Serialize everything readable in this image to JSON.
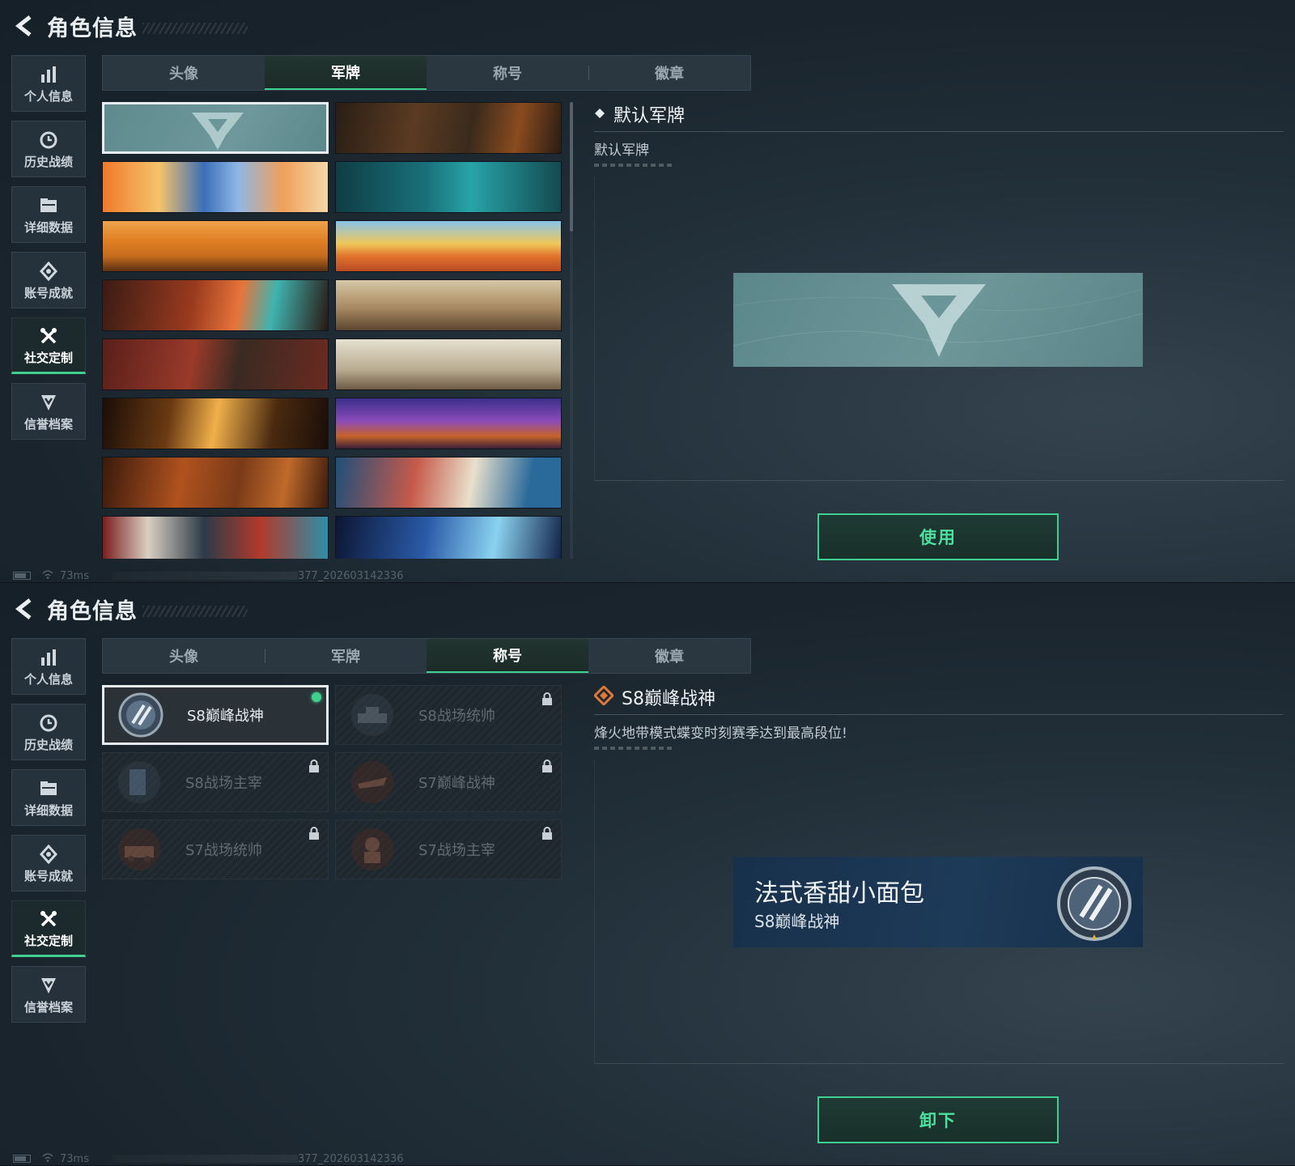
{
  "top": {
    "header": {
      "title": "角色信息"
    },
    "sidebar": [
      {
        "label": "个人信息",
        "icon": "bar-chart-icon"
      },
      {
        "label": "历史战绩",
        "icon": "history-clock-icon"
      },
      {
        "label": "详细数据",
        "icon": "folder-icon"
      },
      {
        "label": "账号成就",
        "icon": "achievement-diamond-icon"
      },
      {
        "label": "社交定制",
        "icon": "tools-cross-icon",
        "active": true
      },
      {
        "label": "信誉档案",
        "icon": "shield-chevron-icon"
      }
    ],
    "tabs": [
      "头像",
      "军牌",
      "称号",
      "徽章"
    ],
    "active_tab": "军牌",
    "detail": {
      "name": "默认军牌",
      "description": "默认军牌"
    },
    "action_label": "使用",
    "status": {
      "ping": "73ms",
      "code": "377_202603142336"
    }
  },
  "bottom": {
    "header": {
      "title": "角色信息"
    },
    "sidebar": [
      {
        "label": "个人信息",
        "icon": "bar-chart-icon"
      },
      {
        "label": "历史战绩",
        "icon": "history-clock-icon"
      },
      {
        "label": "详细数据",
        "icon": "folder-icon"
      },
      {
        "label": "账号成就",
        "icon": "achievement-diamond-icon"
      },
      {
        "label": "社交定制",
        "icon": "tools-cross-icon",
        "active": true
      },
      {
        "label": "信誉档案",
        "icon": "shield-chevron-icon"
      }
    ],
    "tabs": [
      "头像",
      "军牌",
      "称号",
      "徽章"
    ],
    "active_tab": "称号",
    "titles": [
      {
        "name": "S8巅峰战神",
        "locked": false,
        "selected": true,
        "equipped": true
      },
      {
        "name": "S8战场统帅",
        "locked": true
      },
      {
        "name": "S8战场主宰",
        "locked": true
      },
      {
        "name": "S7巅峰战神",
        "locked": true
      },
      {
        "name": "S7战场统帅",
        "locked": true
      },
      {
        "name": "S7战场主宰",
        "locked": true
      }
    ],
    "detail": {
      "name": "S8巅峰战神",
      "description": "烽火地带模式蝶变时刻赛季达到最高段位!"
    },
    "preview": {
      "player_name": "法式香甜小面包",
      "title": "S8巅峰战神"
    },
    "action_label": "卸下",
    "status": {
      "ping": "73ms",
      "code": "377_202603142336"
    }
  },
  "colors": {
    "accent": "#3fcf8f",
    "panel": "#22303a",
    "locked_text": "#5f6a71"
  }
}
